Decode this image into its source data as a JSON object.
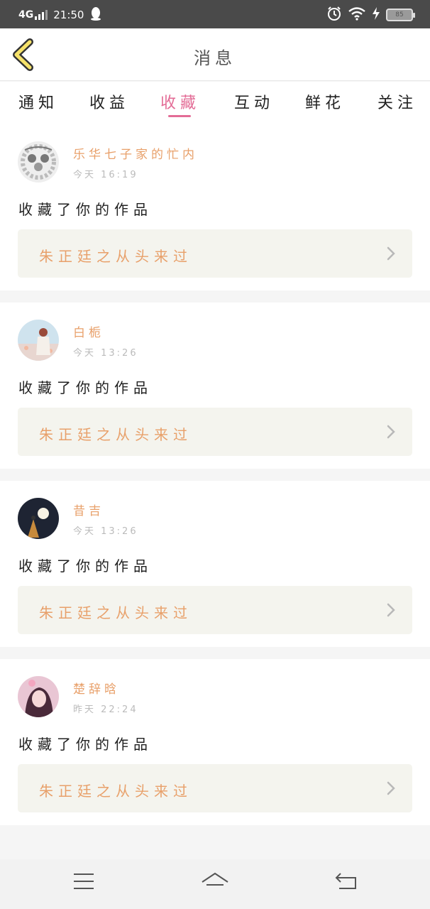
{
  "status_bar": {
    "network": "4G",
    "time": "21:50",
    "battery": "85"
  },
  "header": {
    "title": "消息"
  },
  "tabs": [
    {
      "label": "通知"
    },
    {
      "label": "收益"
    },
    {
      "label": "收藏"
    },
    {
      "label": "互动"
    },
    {
      "label": "鲜花"
    },
    {
      "label": "关注"
    }
  ],
  "active_tab": "收藏",
  "colors": {
    "accent": "#e36c96",
    "username": "#e8a06a",
    "work_title": "#e8a06a",
    "work_box": "#f4f4ee"
  },
  "messages": [
    {
      "username": "乐华七子家的忙内",
      "time": "今天 16:19",
      "action": "收藏了你的作品",
      "work_title": "朱正廷之从头来过",
      "avatar_icon": "group-photo-avatar"
    },
    {
      "username": "白栀",
      "time": "今天 13:26",
      "action": "收藏了你的作品",
      "work_title": "朱正廷之从头来过",
      "avatar_icon": "girl-by-sea-avatar"
    },
    {
      "username": "昔吉",
      "time": "今天 13:26",
      "action": "收藏了你的作品",
      "work_title": "朱正廷之从头来过",
      "avatar_icon": "moon-night-avatar"
    },
    {
      "username": "楚辞晗",
      "time": "昨天 22:24",
      "action": "收藏了你的作品",
      "work_title": "朱正廷之从头来过",
      "avatar_icon": "pink-girl-avatar"
    }
  ]
}
